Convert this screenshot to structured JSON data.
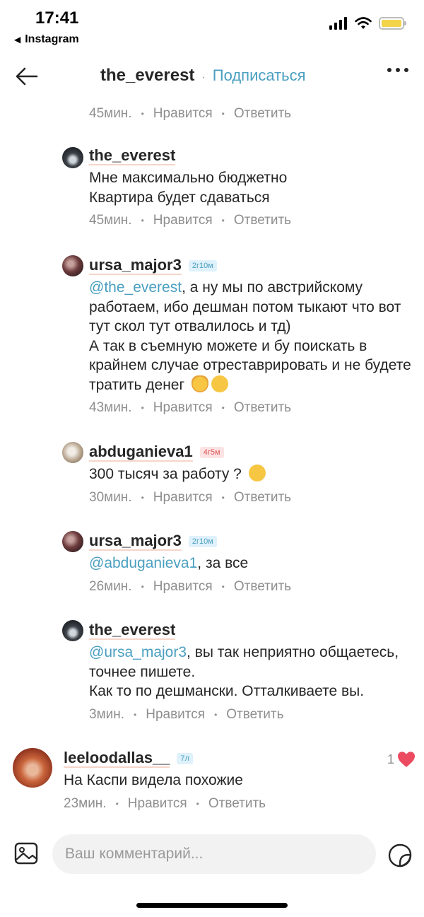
{
  "status_bar": {
    "time": "17:41",
    "back_app": "Instagram",
    "battery_color": "#f2d44a"
  },
  "header": {
    "username": "the_everest",
    "separator": "·",
    "follow_label": "Подписаться"
  },
  "top_meta": {
    "time": "45мин.",
    "like": "Нравится",
    "reply": "Ответить"
  },
  "replies": [
    {
      "username": "the_everest",
      "badge": "",
      "lines": [
        "Мне максимально бюджетно",
        "Квартира будет сдаваться"
      ],
      "time": "45мин.",
      "like": "Нравится",
      "reply": "Ответить"
    },
    {
      "username": "ursa_major3",
      "badge": "2г10м",
      "mention": "@the_everest",
      "text_after_mention": ", а ну мы по австрийскому работаем, ибо дешман потом тыкают что вот тут скол тут отвалилось и тд)",
      "text_line2": "А так в съемную можете и бу поискать в крайнем случае отреставрировать и не будете тратить денег",
      "time": "43мин.",
      "like": "Нравится",
      "reply": "Ответить"
    },
    {
      "username": "abduganieva1",
      "badge": "4г5м",
      "text": "300 тысяч за работу ?",
      "time": "30мин.",
      "like": "Нравится",
      "reply": "Ответить"
    },
    {
      "username": "ursa_major3",
      "badge": "2г10м",
      "mention": "@abduganieva1",
      "text_after_mention": ", за все",
      "time": "26мин.",
      "like": "Нравится",
      "reply": "Ответить"
    },
    {
      "username": "the_everest",
      "badge": "",
      "mention": "@ursa_major3",
      "text_after_mention": ", вы так неприятно общаетесь, точнее пишете.",
      "text_line2": "Как то по дешмански. Отталкиваете вы.",
      "time": "3мин.",
      "like": "Нравится",
      "reply": "Ответить"
    }
  ],
  "top_comment": {
    "username": "leeloodallas__",
    "badge": "7л",
    "text": "На Каспи видела похожие",
    "like_count": "1",
    "time": "23мин.",
    "like": "Нравится",
    "reply": "Ответить"
  },
  "composer": {
    "placeholder": "Ваш комментарий..."
  },
  "colors": {
    "accent": "#4a9fc0",
    "like_red": "#ec4a60",
    "muted": "#8e8e8e"
  }
}
